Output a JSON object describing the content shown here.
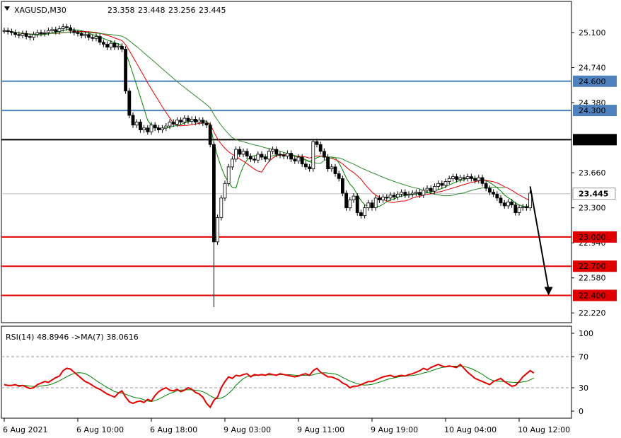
{
  "chart_data": [
    {
      "type": "candlestick",
      "symbol_header": "XAGUSD,M30",
      "ohlc_header": [
        "23.358",
        "23.448",
        "23.256",
        "23.445"
      ],
      "last_price_label": "23.445",
      "ylim": [
        22.12,
        25.42
      ],
      "y_ticks": [
        "25.100",
        "24.740",
        "24.380",
        "23.660",
        "23.300",
        "22.940",
        "22.580",
        "22.220"
      ],
      "x_tick_labels": [
        "6 Aug 2021",
        "6 Aug 10:00",
        "6 Aug 18:00",
        "9 Aug 03:00",
        "9 Aug 11:00",
        "9 Aug 19:00",
        "10 Aug 04:00",
        "10 Aug 12:00"
      ],
      "x_tick_bar_index": [
        0,
        20,
        40,
        60,
        80,
        100,
        120,
        140
      ],
      "close": [
        25.12,
        25.11,
        25.1,
        25.08,
        25.07,
        25.09,
        25.06,
        25.05,
        25.08,
        25.1,
        25.09,
        25.1,
        25.12,
        25.13,
        25.11,
        25.14,
        25.16,
        25.15,
        25.12,
        25.1,
        25.09,
        25.07,
        25.08,
        25.05,
        25.04,
        25.06,
        25.0,
        24.98,
        24.95,
        24.99,
        24.95,
        24.96,
        24.93,
        24.5,
        24.25,
        24.15,
        24.18,
        24.1,
        24.12,
        24.08,
        24.15,
        24.12,
        24.1,
        24.12,
        24.14,
        24.18,
        24.16,
        24.2,
        24.18,
        24.22,
        24.19,
        24.21,
        24.18,
        24.2,
        24.17,
        24.15,
        23.95,
        22.95,
        23.2,
        23.4,
        23.55,
        23.72,
        23.8,
        23.9,
        23.85,
        23.88,
        23.83,
        23.8,
        23.79,
        23.85,
        23.82,
        23.8,
        23.88,
        23.9,
        23.85,
        23.84,
        23.83,
        23.86,
        23.8,
        23.78,
        23.82,
        23.75,
        23.72,
        23.7,
        23.98,
        23.95,
        23.88,
        23.82,
        23.7,
        23.72,
        23.65,
        23.6,
        23.45,
        23.3,
        23.38,
        23.42,
        23.25,
        23.22,
        23.3,
        23.35,
        23.3,
        23.4,
        23.38,
        23.41,
        23.4,
        23.43,
        23.41,
        23.44,
        23.46,
        23.43,
        23.44,
        23.45,
        23.46,
        23.43,
        23.48,
        23.5,
        23.47,
        23.52,
        23.55,
        23.53,
        23.57,
        23.6,
        23.62,
        23.59,
        23.61,
        23.6,
        23.62,
        23.6,
        23.58,
        23.61,
        23.55,
        23.5,
        23.46,
        23.44,
        23.4,
        23.35,
        23.32,
        23.36,
        23.33,
        23.25,
        23.3,
        23.31,
        23.3,
        23.45
      ],
      "horizontal_levels": [
        {
          "value": 24.6,
          "label": "24.600",
          "color": "#4f81bd"
        },
        {
          "value": 24.3,
          "label": "24.300",
          "color": "#4f81bd"
        },
        {
          "value": 24.0,
          "label": "24.000",
          "color": "#000000"
        },
        {
          "value": 23.0,
          "label": "23.000",
          "color": "#e00000"
        },
        {
          "value": 22.7,
          "label": "22.700",
          "color": "#e00000"
        },
        {
          "value": 22.4,
          "label": "22.400",
          "color": "#e00000"
        }
      ],
      "forecast_arrow": {
        "from_bar": 143,
        "from_value": 23.52,
        "to_bar": 148,
        "to_value": 22.4
      },
      "ma_colors": {
        "fast": "#008000",
        "medium": "#e00000",
        "slow": "#2e8b2e"
      }
    },
    {
      "type": "line",
      "indicator_header": "RSI(14) 48.8946   ->MA(7) 38.0616",
      "ylim": [
        0,
        100
      ],
      "y_ticks": [
        "100",
        "70",
        "30",
        "0"
      ],
      "levels": [
        30,
        70
      ],
      "rsi_values": [
        34,
        33,
        33,
        34,
        32,
        33,
        31,
        29,
        30,
        34,
        36,
        38,
        37,
        40,
        43,
        45,
        52,
        55,
        54,
        50,
        46,
        42,
        38,
        36,
        33,
        30,
        28,
        25,
        22,
        20,
        18,
        23,
        26,
        18,
        12,
        10,
        12,
        13,
        11,
        15,
        13,
        20,
        25,
        28,
        30,
        27,
        26,
        28,
        25,
        27,
        30,
        28,
        24,
        22,
        18,
        10,
        5,
        14,
        18,
        30,
        38,
        44,
        42,
        46,
        45,
        47,
        48,
        44,
        47,
        46,
        47,
        46,
        48,
        47,
        46,
        48,
        47,
        46,
        45,
        44,
        45,
        47,
        48,
        46,
        52,
        55,
        50,
        47,
        44,
        44,
        42,
        40,
        36,
        34,
        30,
        32,
        32,
        34,
        36,
        38,
        38,
        40,
        42,
        44,
        45,
        46,
        44,
        45,
        46,
        45,
        47,
        48,
        50,
        52,
        55,
        53,
        56,
        58,
        60,
        58,
        57,
        58,
        57,
        56,
        60,
        55,
        50,
        46,
        42,
        40,
        38,
        36,
        34,
        38,
        40,
        42,
        38,
        35,
        32,
        33,
        38,
        44,
        48,
        52,
        48.89
      ]
    }
  ]
}
